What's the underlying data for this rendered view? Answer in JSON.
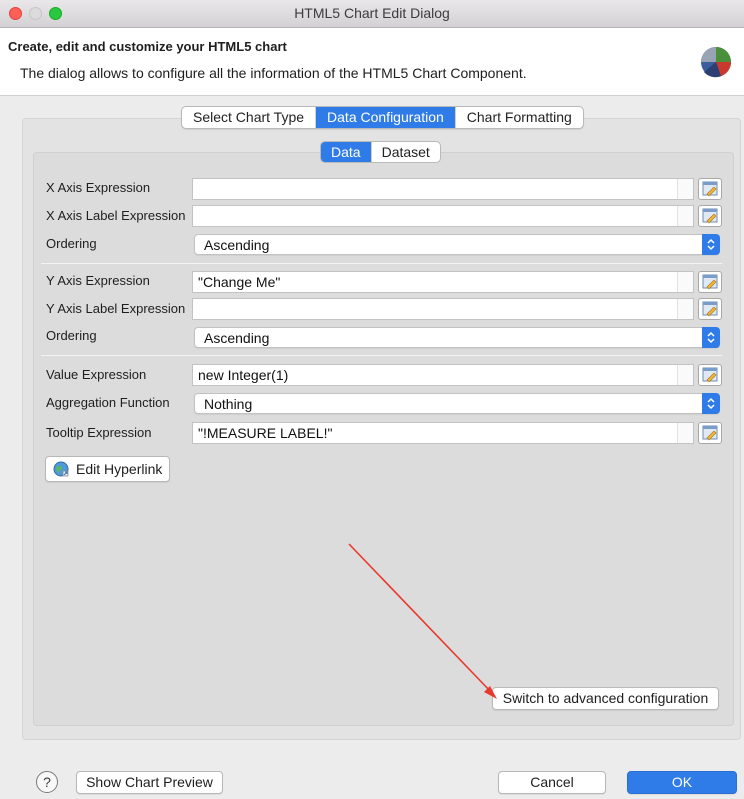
{
  "window": {
    "title": "HTML5 Chart Edit Dialog"
  },
  "header": {
    "title": "Create, edit and customize your HTML5 chart",
    "description": "The dialog allows to configure all the information of the HTML5 Chart Component.",
    "icon": "pie-chart-icon"
  },
  "tabs": [
    {
      "label": "Select Chart Type",
      "active": false
    },
    {
      "label": "Data Configuration",
      "active": true
    },
    {
      "label": "Chart Formatting",
      "active": false
    }
  ],
  "subtabs": [
    {
      "label": "Data",
      "active": true
    },
    {
      "label": "Dataset",
      "active": false
    }
  ],
  "fields": {
    "x_axis_expression": {
      "label": "X Axis Expression",
      "value": ""
    },
    "x_axis_label_expression": {
      "label": "X Axis Label Expression",
      "value": ""
    },
    "x_ordering": {
      "label": "Ordering",
      "value": "Ascending"
    },
    "y_axis_expression": {
      "label": "Y Axis Expression",
      "value": "\"Change Me\""
    },
    "y_axis_label_expression": {
      "label": "Y Axis Label Expression",
      "value": ""
    },
    "y_ordering": {
      "label": "Ordering",
      "value": "Ascending"
    },
    "value_expression": {
      "label": "Value Expression",
      "value": "new Integer(1)"
    },
    "aggregation_function": {
      "label": "Aggregation Function",
      "value": "Nothing"
    },
    "tooltip_expression": {
      "label": "Tooltip Expression",
      "value": "\"!MEASURE LABEL!\""
    }
  },
  "buttons": {
    "edit_hyperlink": "Edit Hyperlink",
    "switch_advanced": "Switch to advanced configuration",
    "show_preview": "Show Chart Preview",
    "cancel": "Cancel",
    "ok": "OK",
    "help": "?"
  },
  "colors": {
    "accent": "#2f7ce8",
    "annotation_arrow": "#e8392d"
  }
}
